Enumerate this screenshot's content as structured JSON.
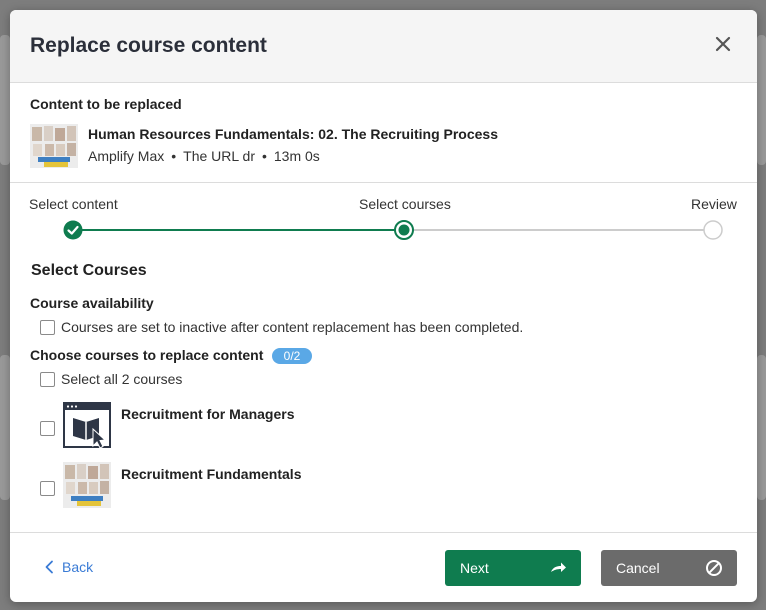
{
  "modal": {
    "title": "Replace course content",
    "close_icon": "close-icon"
  },
  "content_section": {
    "label": "Content to be replaced",
    "item": {
      "title": "Human Resources Fundamentals: 02. The Recruiting Process",
      "provider": "Amplify Max",
      "source": "The URL dr",
      "duration": "13m 0s",
      "separator": "•"
    }
  },
  "stepper": {
    "steps": [
      {
        "label": "Select content",
        "state": "complete"
      },
      {
        "label": "Select courses",
        "state": "current"
      },
      {
        "label": "Review",
        "state": "pending"
      }
    ],
    "colors": {
      "active": "#0f7c4f",
      "inactive": "#cccccc"
    }
  },
  "select_courses": {
    "title": "Select Courses",
    "availability_label": "Course availability",
    "inactive_option": "Courses are set to inactive after content replacement has been completed.",
    "choose_label": "Choose courses to replace content",
    "count_badge": "0/2",
    "select_all": "Select all 2 courses",
    "courses": [
      {
        "title": "Recruitment for Managers",
        "icon": "book-cursor-icon"
      },
      {
        "title": "Recruitment Fundamentals",
        "icon": "course-thumbnail"
      }
    ]
  },
  "footer": {
    "back_label": "Back",
    "next_label": "Next",
    "cancel_label": "Cancel"
  }
}
